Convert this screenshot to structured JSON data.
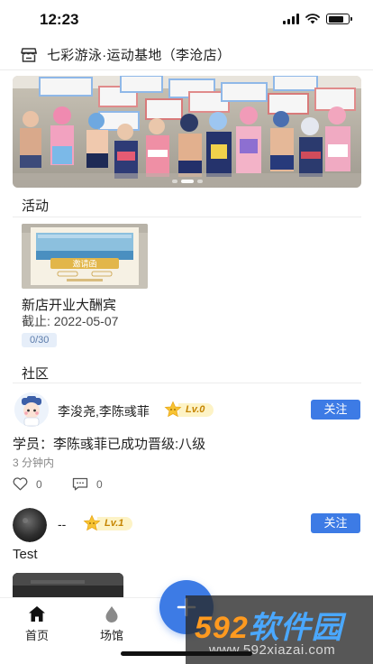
{
  "status_bar": {
    "time": "12:23"
  },
  "header": {
    "store_name": "七彩游泳·运动基地（李沧店）"
  },
  "sections": {
    "activity_title": "活动",
    "community_title": "社区"
  },
  "activity": {
    "title": "新店开业大酬宾",
    "deadline": "截止: 2022-05-07",
    "count": "0/30",
    "poster_text": "邀请函"
  },
  "posts": [
    {
      "user": "李浚尧,李陈彧菲",
      "level": "Lv.0",
      "follow_label": "关注",
      "content": "学员：李陈彧菲已成功晋级:八级",
      "time": "3 分钟内",
      "likes": "0",
      "comments": "0"
    },
    {
      "user": "--",
      "level": "Lv.1",
      "follow_label": "关注",
      "content": "Test"
    }
  ],
  "nav": {
    "home": "首页",
    "venue": "场馆"
  },
  "watermark": {
    "number": "592",
    "brand": "软件园",
    "url": "www.592xiazai.com"
  },
  "colors": {
    "accent": "#3d7be5",
    "badge_bg": "#fdf3c6",
    "badge_text": "#c58400"
  }
}
